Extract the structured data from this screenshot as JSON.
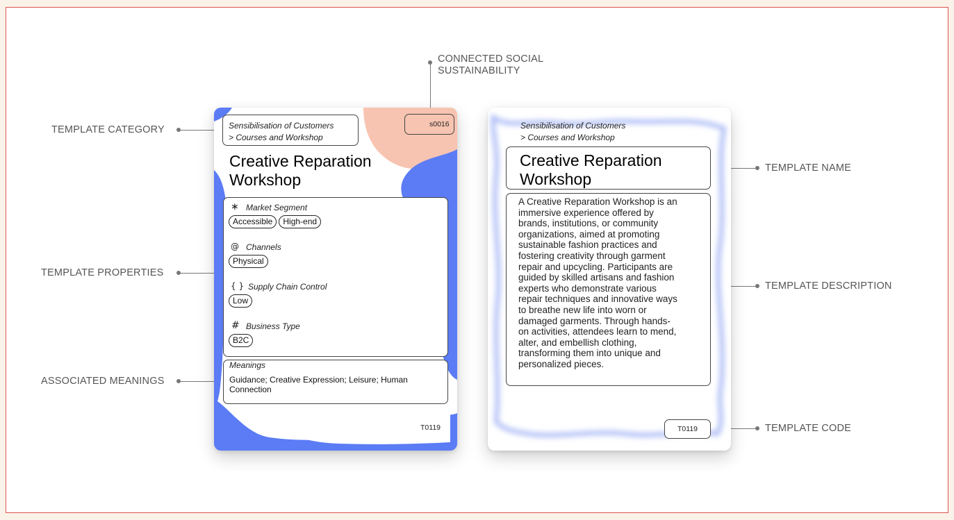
{
  "callouts": {
    "template_category": "TEMPLATE CATEGORY",
    "template_properties": "TEMPLATE PROPERTIES",
    "associated_meanings": "ASSOCIATED MEANINGS",
    "connected_social_line1": "CONNECTED SOCIAL",
    "connected_social_line2": "SUSTAINABILITY",
    "template_name": "TEMPLATE NAME",
    "template_description": "TEMPLATE DESCRIPTION",
    "template_code": "TEMPLATE CODE"
  },
  "front": {
    "category_line1": "Sensibilisation of Customers",
    "category_line2": "> Courses and Workshop",
    "sustainability_code": "s0016",
    "title_line1": "Creative Reparation",
    "title_line2": "Workshop",
    "properties": [
      {
        "symbol": "∗",
        "label": "Market Segment",
        "tags": [
          "Accessible",
          "High-end"
        ]
      },
      {
        "symbol": "@",
        "label": "Channels",
        "tags": [
          "Physical"
        ]
      },
      {
        "symbol": "{ }",
        "label": "Supply Chain Control",
        "tags": [
          "Low"
        ]
      },
      {
        "symbol": "#",
        "label": "Business Type",
        "tags": [
          "B2C"
        ]
      }
    ],
    "meanings_title": "Meanings",
    "meanings_line1": "Guidance; Creative Expression; Leisure; Human",
    "meanings_line2": "Connection",
    "template_code": "T0119"
  },
  "back": {
    "category_line1": "Sensibilisation of Customers",
    "category_line2": "> Courses and Workshop",
    "title_line1": "Creative Reparation",
    "title_line2": "Workshop",
    "description_lines": [
      "A Creative Reparation Workshop is an",
      "immersive experience offered by",
      "brands, institutions, or community",
      "organizations, aimed at promoting",
      "sustainable fashion practices and",
      "fostering creativity through garment",
      "repair and upcycling. Participants are",
      "guided by skilled artisans and fashion",
      "experts who demonstrate various",
      "repair techniques and innovative ways",
      "to breathe new life into worn or",
      "damaged garments. Through hands-",
      "on activities, attendees learn to mend,",
      "alter, and embellish clothing,",
      "transforming them into unique and",
      "personalized pieces."
    ],
    "template_code": "T0119"
  },
  "colors": {
    "front_blue": "#5b7cf5",
    "front_peach": "#f7c4b1",
    "back_glow": "#b9c6f7",
    "frame_border": "#e0524f"
  }
}
